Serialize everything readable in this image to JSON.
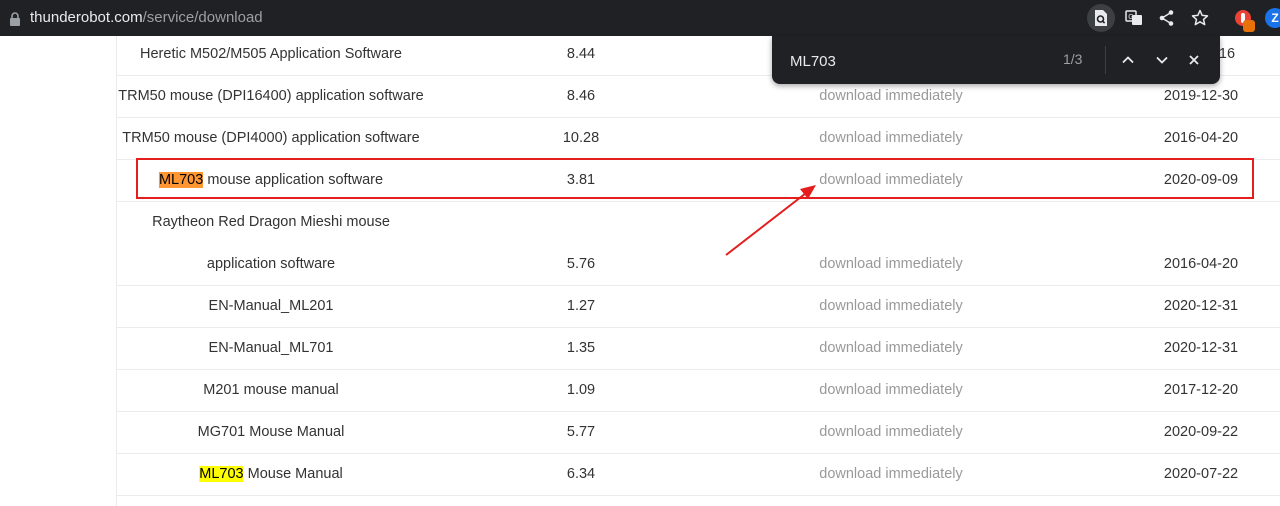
{
  "browser": {
    "url_host": "thunderobot.com",
    "url_path": "/service/download",
    "ext_letter": "Z"
  },
  "find_bar": {
    "query": "ML703",
    "count": "1/3"
  },
  "rows": [
    {
      "name_pre": "",
      "match": "",
      "name_post": "Heretic M502/M505 Application Software",
      "version": "8.44",
      "download": "",
      "date": ""
    },
    {
      "name_pre": "",
      "match": "",
      "name_post": "TRM50 mouse (DPI16400) application software",
      "version": "8.46",
      "download": "download immediately",
      "date": "2019-12-30"
    },
    {
      "name_pre": "",
      "match": "",
      "name_post": "TRM50 mouse (DPI4000) application software",
      "version": "10.28",
      "download": "download immediately",
      "date": "2016-04-20"
    },
    {
      "name_pre": "",
      "match": "ML703",
      "name_post": " mouse application software",
      "version": "3.81",
      "download": "download immediately",
      "date": "2020-09-09"
    },
    {
      "name_pre": "",
      "match": "",
      "name_post": "Raytheon Red Dragon Mieshi mouse",
      "version": "",
      "download": "",
      "date": ""
    },
    {
      "name_pre": "",
      "match": "",
      "name_post": "application software",
      "version": "5.76",
      "download": "download immediately",
      "date": "2016-04-20"
    },
    {
      "name_pre": "",
      "match": "",
      "name_post": "EN-Manual_ML201",
      "version": "1.27",
      "download": "download immediately",
      "date": "2020-12-31"
    },
    {
      "name_pre": "",
      "match": "",
      "name_post": "EN-Manual_ML701",
      "version": "1.35",
      "download": "download immediately",
      "date": "2020-12-31"
    },
    {
      "name_pre": "",
      "match": "",
      "name_post": "M201 mouse manual",
      "version": "1.09",
      "download": "download immediately",
      "date": "2017-12-20"
    },
    {
      "name_pre": "",
      "match": "",
      "name_post": "MG701 Mouse Manual",
      "version": "5.77",
      "download": "download immediately",
      "date": "2020-09-22"
    },
    {
      "name_pre": "",
      "match": "ML703",
      "name_post": " Mouse Manual",
      "version": "6.34",
      "download": "download immediately",
      "date": "2020-07-22"
    }
  ],
  "partial_date_row0": "16",
  "colors": {
    "annotation": "#e41d1d",
    "current_match": "#ff9632",
    "other_match": "#ffff00"
  }
}
